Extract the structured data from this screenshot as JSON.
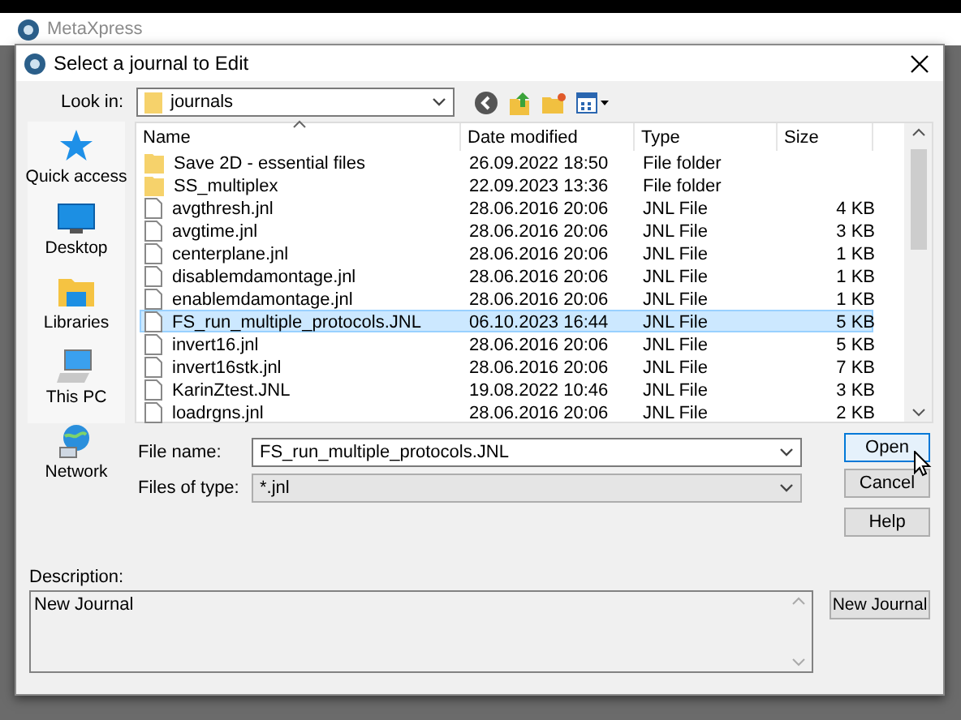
{
  "app_window": {
    "title": "MetaXpress"
  },
  "dialog": {
    "title": "Select a journal to Edit",
    "look_in": {
      "label": "Look in:",
      "value": "journals"
    },
    "places": [
      {
        "kind": "star",
        "label": "Quick access"
      },
      {
        "kind": "desktop",
        "label": "Desktop"
      },
      {
        "kind": "libraries",
        "label": "Libraries"
      },
      {
        "kind": "pc",
        "label": "This PC"
      },
      {
        "kind": "network",
        "label": "Network"
      }
    ],
    "columns": [
      "Name",
      "Date modified",
      "Type",
      "Size"
    ],
    "rows": [
      {
        "kind": "folder",
        "name": "Save 2D - essential files",
        "date": "26.09.2022 18:50",
        "type": "File folder",
        "size": "",
        "selected": false
      },
      {
        "kind": "folder",
        "name": "SS_multiplex",
        "date": "22.09.2023 13:36",
        "type": "File folder",
        "size": "",
        "selected": false
      },
      {
        "kind": "file",
        "name": "avgthresh.jnl",
        "date": "28.06.2016 20:06",
        "type": "JNL File",
        "size": "4 KB",
        "selected": false
      },
      {
        "kind": "file",
        "name": "avgtime.jnl",
        "date": "28.06.2016 20:06",
        "type": "JNL File",
        "size": "3 KB",
        "selected": false
      },
      {
        "kind": "file",
        "name": "centerplane.jnl",
        "date": "28.06.2016 20:06",
        "type": "JNL File",
        "size": "1 KB",
        "selected": false
      },
      {
        "kind": "file",
        "name": "disablemdamontage.jnl",
        "date": "28.06.2016 20:06",
        "type": "JNL File",
        "size": "1 KB",
        "selected": false
      },
      {
        "kind": "file",
        "name": "enablemdamontage.jnl",
        "date": "28.06.2016 20:06",
        "type": "JNL File",
        "size": "1 KB",
        "selected": false
      },
      {
        "kind": "file",
        "name": "FS_run_multiple_protocols.JNL",
        "date": "06.10.2023 16:44",
        "type": "JNL File",
        "size": "5 KB",
        "selected": true
      },
      {
        "kind": "file",
        "name": "invert16.jnl",
        "date": "28.06.2016 20:06",
        "type": "JNL File",
        "size": "5 KB",
        "selected": false
      },
      {
        "kind": "file",
        "name": "invert16stk.jnl",
        "date": "28.06.2016 20:06",
        "type": "JNL File",
        "size": "7 KB",
        "selected": false
      },
      {
        "kind": "file",
        "name": "KarinZtest.JNL",
        "date": "19.08.2022 10:46",
        "type": "JNL File",
        "size": "3 KB",
        "selected": false
      },
      {
        "kind": "file",
        "name": "loadrgns.jnl",
        "date": "28.06.2016 20:06",
        "type": "JNL File",
        "size": "2 KB",
        "selected": false
      }
    ],
    "file_name": {
      "label": "File name:",
      "value": "FS_run_multiple_protocols.JNL"
    },
    "files_of_type": {
      "label": "Files of type:",
      "value": "*.jnl"
    },
    "buttons": [
      "Open",
      "Cancel",
      "Help"
    ],
    "description": {
      "label": "Description:",
      "value": "New Journal"
    },
    "new_journal_button": "New Journal"
  }
}
